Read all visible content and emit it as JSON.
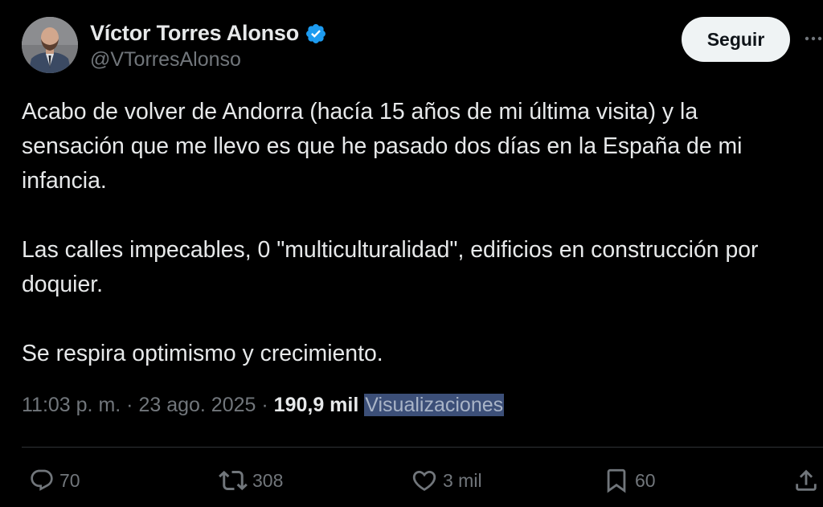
{
  "user": {
    "display_name": "Víctor Torres Alonso",
    "handle": "@VTorresAlonso",
    "verified_icon": "verified-badge-icon",
    "avatar": "profile-photo"
  },
  "header": {
    "follow_label": "Seguir",
    "more_icon": "more-horizontal-icon"
  },
  "tweet": {
    "paragraphs": [
      "Acabo de volver de Andorra (hacía 15 años de mi última visita) y la sensación que me llevo es que he pasado dos días en la España de mi infancia.",
      "Las calles impecables, 0 \"multiculturalidad\", edificios en construcción por doquier.",
      "Se respira optimismo y crecimiento."
    ]
  },
  "meta": {
    "time": "11:03 p. m.",
    "sep1": "·",
    "date": "23 ago. 2025",
    "sep2": "·",
    "views_count": "190,9 mil",
    "views_label": "Visualizaciones"
  },
  "actions": {
    "replies": "70",
    "retweets": "308",
    "likes": "3 mil",
    "bookmarks": "60"
  },
  "colors": {
    "background": "#000000",
    "text_primary": "#e7e9ea",
    "text_secondary": "#71767b",
    "verified_blue": "#1d9bf0",
    "follow_bg": "#eff3f4",
    "selection_highlight": "#3c4f78",
    "divider": "#2f3336"
  }
}
